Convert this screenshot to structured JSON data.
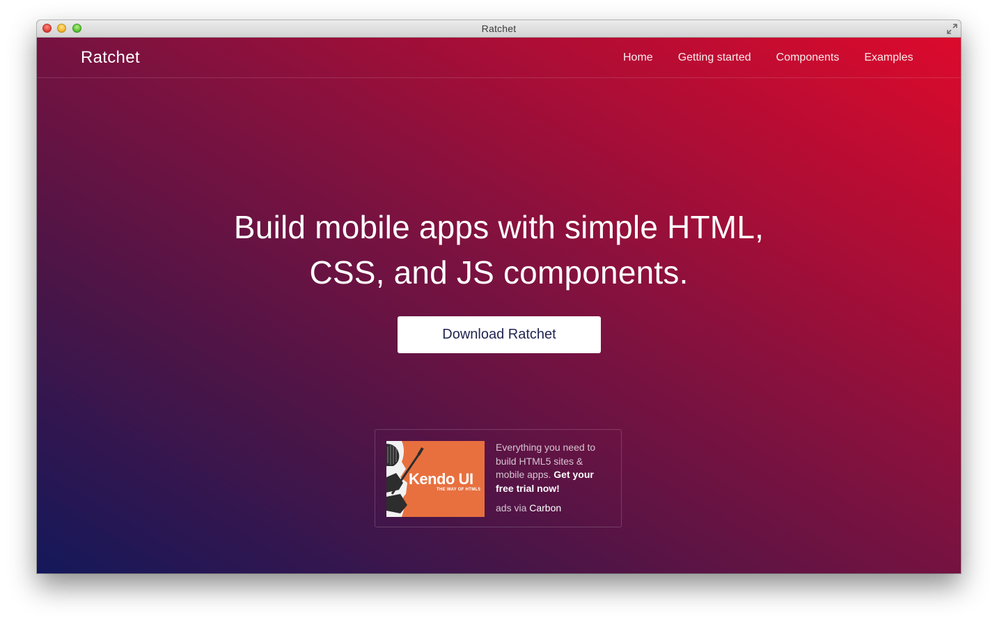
{
  "window": {
    "title": "Ratchet"
  },
  "navbar": {
    "brand": "Ratchet",
    "links": [
      {
        "label": "Home"
      },
      {
        "label": "Getting started"
      },
      {
        "label": "Components"
      },
      {
        "label": "Examples"
      }
    ]
  },
  "hero": {
    "title_line1": "Build mobile apps with simple HTML,",
    "title_line2": "CSS, and JS components.",
    "download_label": "Download Ratchet"
  },
  "ad": {
    "image_logo": "Kendo UI",
    "image_tagline": "THE WAY OF HTML5",
    "text": "Everything you need to build HTML5 sites & mobile apps.",
    "cta": "Get your free trial now!",
    "via_prefix": "ads via",
    "via_link": "Carbon",
    "colors": {
      "image_bg": "#e8703f"
    }
  },
  "colors": {
    "gradient_start": "#14185a",
    "gradient_end": "#dc0a2c",
    "button_text": "#1f2350"
  }
}
